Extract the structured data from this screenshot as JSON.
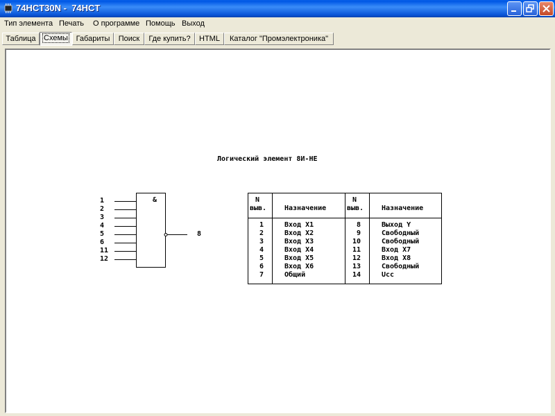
{
  "window": {
    "title": "74HCT30N -  74HCT"
  },
  "menu": [
    "Тип элемента",
    "Печать",
    "О программе",
    "Помощь",
    "Выход"
  ],
  "tabs": [
    {
      "label": "Таблица",
      "active": false
    },
    {
      "label": "Схемы",
      "active": true
    },
    {
      "label": "Габариты",
      "active": false
    },
    {
      "label": "Поиск",
      "active": false
    },
    {
      "label": "Где купить?",
      "active": false
    },
    {
      "label": "HTML",
      "active": false
    },
    {
      "label": "Каталог \"Промэлектроника\"",
      "active": false
    }
  ],
  "schematic": {
    "heading": "Логический элемент 8И-НЕ",
    "gate_symbol": "&",
    "input_pins": [
      "1",
      "2",
      "3",
      "4",
      "5",
      "6",
      "11",
      "12"
    ],
    "output_pin": "8",
    "table": {
      "headers": {
        "n_line1": "N",
        "n_line2": "выв.",
        "purpose": "Назначение"
      },
      "left": [
        {
          "n": "1",
          "name": "Вход X1"
        },
        {
          "n": "2",
          "name": "Вход X2"
        },
        {
          "n": "3",
          "name": "Вход X3"
        },
        {
          "n": "4",
          "name": "Вход X4"
        },
        {
          "n": "5",
          "name": "Вход X5"
        },
        {
          "n": "6",
          "name": "Вход X6"
        },
        {
          "n": "7",
          "name": "Общий"
        }
      ],
      "right": [
        {
          "n": "8",
          "name": "Выход Y"
        },
        {
          "n": "9",
          "name": "Свободный"
        },
        {
          "n": "10",
          "name": "Свободный"
        },
        {
          "n": "11",
          "name": "Вход X7"
        },
        {
          "n": "12",
          "name": "Вход X8"
        },
        {
          "n": "13",
          "name": "Свободный"
        },
        {
          "n": "14",
          "name": "Ucc"
        }
      ]
    }
  }
}
